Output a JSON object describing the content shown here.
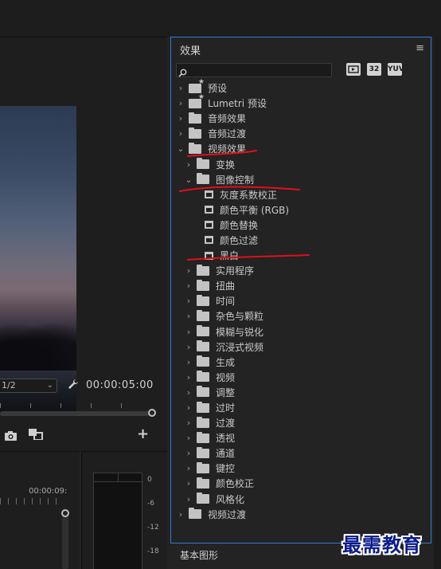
{
  "monitor": {
    "resolution": "1/2",
    "timecode": "00:00:05:00"
  },
  "timeline": {
    "tick_label": "00:00:09:",
    "meter_db": [
      "0",
      "-6",
      "-12",
      "-18"
    ]
  },
  "effects_panel": {
    "title": "效果",
    "menu_icon": "≡",
    "search": {
      "value": "",
      "placeholder": ""
    },
    "filter_buttons": [
      "32",
      "YUV"
    ],
    "items": [
      {
        "label": "预设",
        "type": "preset",
        "level": 0,
        "expanded": false
      },
      {
        "label": "Lumetri 预设",
        "type": "preset",
        "level": 0,
        "expanded": false
      },
      {
        "label": "音频效果",
        "type": "folder",
        "level": 0,
        "expanded": false
      },
      {
        "label": "音频过渡",
        "type": "folder",
        "level": 0,
        "expanded": false
      },
      {
        "label": "视频效果",
        "type": "folder",
        "level": 0,
        "expanded": true
      },
      {
        "label": "变换",
        "type": "folder",
        "level": 1,
        "expanded": false
      },
      {
        "label": "图像控制",
        "type": "folder",
        "level": 1,
        "expanded": true
      },
      {
        "label": "灰度系数校正",
        "type": "effect",
        "level": 2
      },
      {
        "label": "颜色平衡 (RGB)",
        "type": "effect",
        "level": 2
      },
      {
        "label": "颜色替换",
        "type": "effect",
        "level": 2
      },
      {
        "label": "颜色过滤",
        "type": "effect",
        "level": 2
      },
      {
        "label": "黑白",
        "type": "effect",
        "level": 2
      },
      {
        "label": "实用程序",
        "type": "folder",
        "level": 1,
        "expanded": false
      },
      {
        "label": "扭曲",
        "type": "folder",
        "level": 1,
        "expanded": false
      },
      {
        "label": "时间",
        "type": "folder",
        "level": 1,
        "expanded": false
      },
      {
        "label": "杂色与颗粒",
        "type": "folder",
        "level": 1,
        "expanded": false
      },
      {
        "label": "模糊与锐化",
        "type": "folder",
        "level": 1,
        "expanded": false
      },
      {
        "label": "沉浸式视频",
        "type": "folder",
        "level": 1,
        "expanded": false
      },
      {
        "label": "生成",
        "type": "folder",
        "level": 1,
        "expanded": false
      },
      {
        "label": "视频",
        "type": "folder",
        "level": 1,
        "expanded": false
      },
      {
        "label": "调整",
        "type": "folder",
        "level": 1,
        "expanded": false
      },
      {
        "label": "过时",
        "type": "folder",
        "level": 1,
        "expanded": false
      },
      {
        "label": "过渡",
        "type": "folder",
        "level": 1,
        "expanded": false
      },
      {
        "label": "透视",
        "type": "folder",
        "level": 1,
        "expanded": false
      },
      {
        "label": "通道",
        "type": "folder",
        "level": 1,
        "expanded": false
      },
      {
        "label": "键控",
        "type": "folder",
        "level": 1,
        "expanded": false
      },
      {
        "label": "颜色校正",
        "type": "folder",
        "level": 1,
        "expanded": false
      },
      {
        "label": "风格化",
        "type": "folder",
        "level": 1,
        "expanded": false
      },
      {
        "label": "视频过渡",
        "type": "folder",
        "level": 0,
        "expanded": false
      }
    ]
  },
  "basic_graphics": {
    "label": "基本图形"
  },
  "watermark": "最需教育",
  "colors": {
    "panel_focus": "#2f7bd6",
    "annotation": "#e0101a",
    "watermark": "#0a1a8c"
  }
}
